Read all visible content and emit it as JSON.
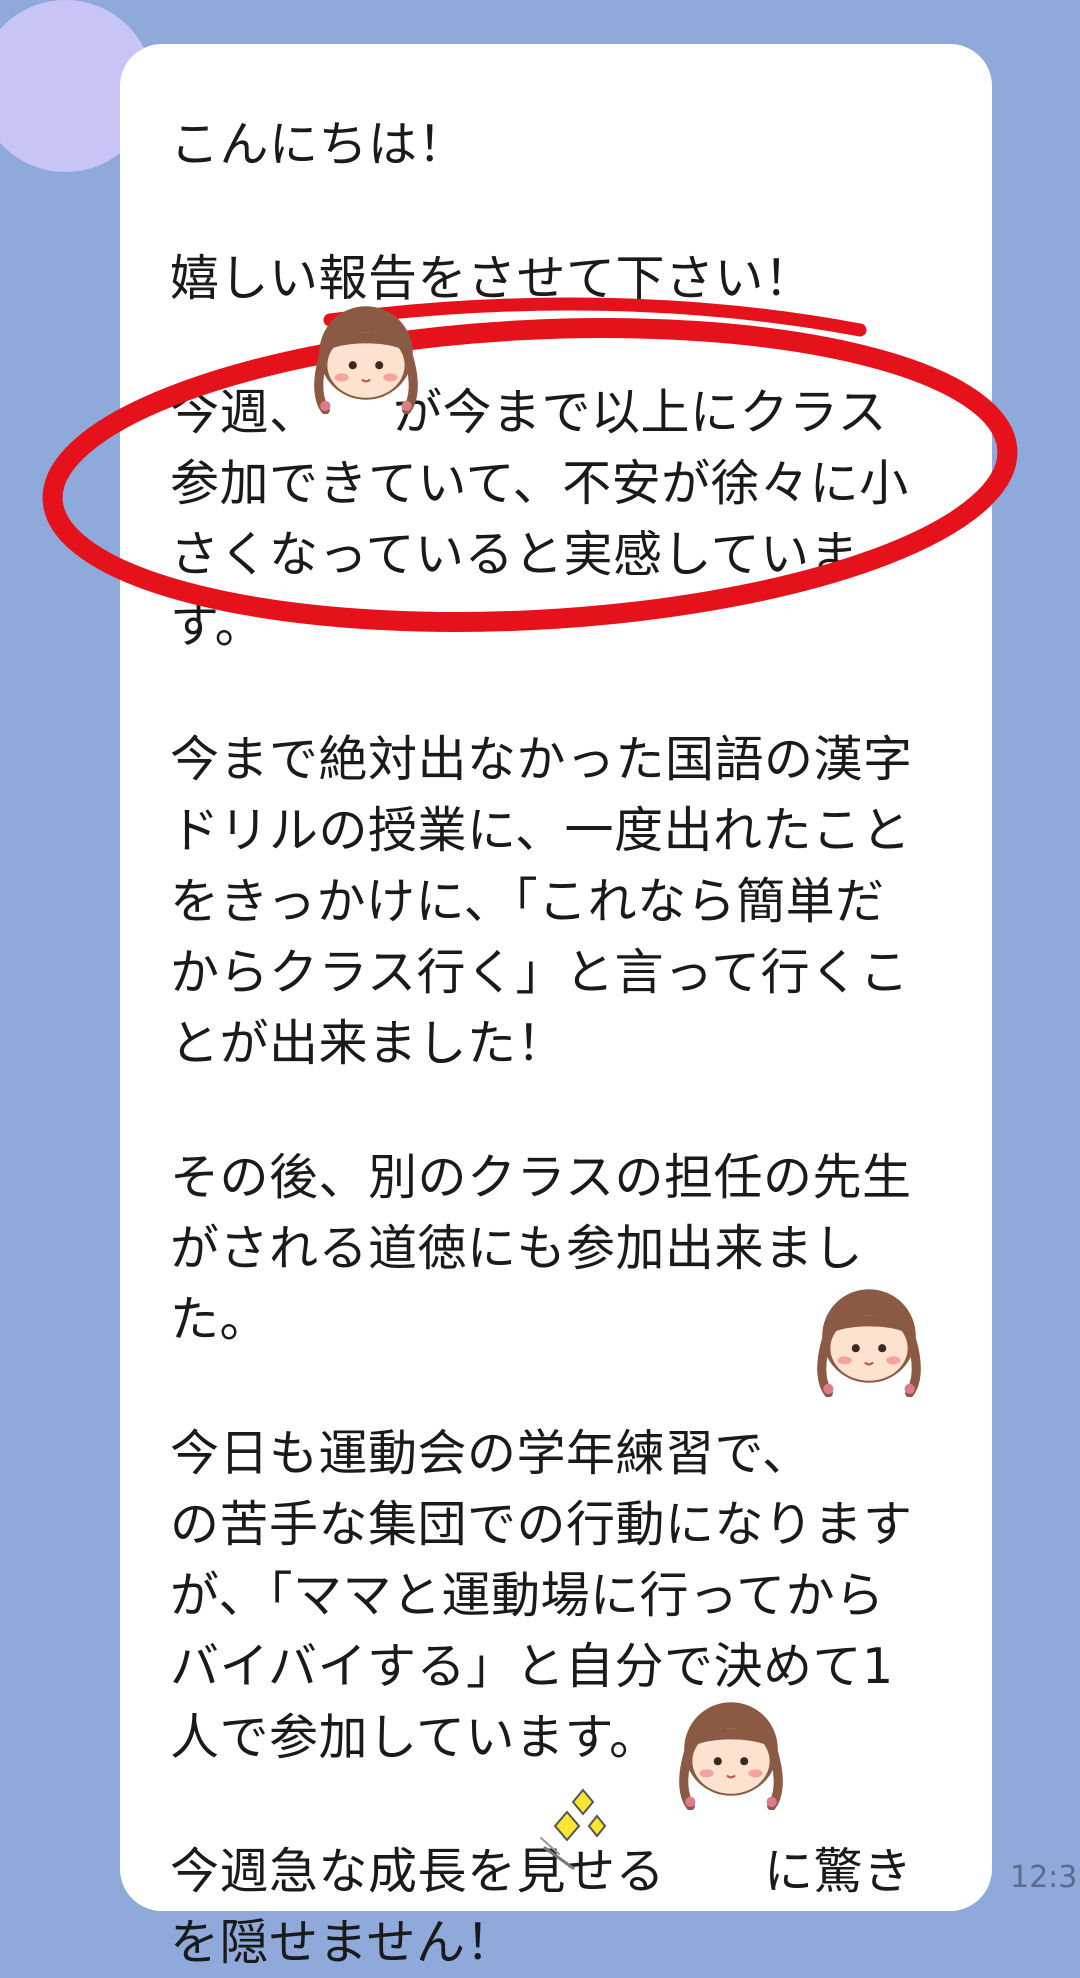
{
  "message": {
    "paragraphs": [
      [
        "こんにちは！"
      ],
      [
        "嬉しい報告をさせて下さい！"
      ],
      [
        "今週、　　が今まで以上にクラス",
        "参加できていて、不安が徐々に小",
        "さくなっていると実感していま",
        "す。"
      ],
      [
        "今まで絶対出なかった国語の漢字",
        "ドリルの授業に、一度出れたこと",
        "をきっかけに、「これなら簡単だ",
        "からクラス行く」と言って行くこ",
        "とが出来ました！"
      ],
      [
        "その後、別のクラスの担任の先生",
        "がされる道徳にも参加出来まし",
        "た。"
      ],
      [
        "今日も運動会の学年練習で、　　",
        "の苦手な集団での行動になります",
        "が、「ママと運動場に行ってから",
        "バイバイする」と自分で決めて1",
        "人で参加しています。"
      ],
      [
        "今週急な成長を見せる　　に驚き",
        "を隠せません！"
      ]
    ],
    "timestamp": "12:3"
  },
  "icons": {
    "child_sticker": "girl-face-icon",
    "sparkle": "sparkle-icon"
  },
  "colors": {
    "background": "#8ea9da",
    "bubble": "#ffffff",
    "highlight_circle": "#e5121c",
    "avatar": "#c8c4f6"
  }
}
